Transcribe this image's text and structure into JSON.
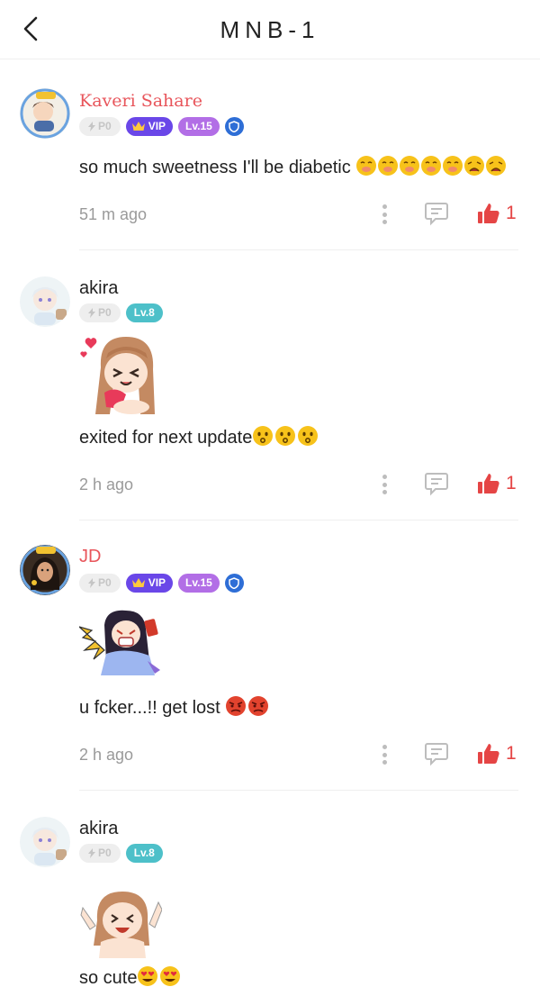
{
  "header": {
    "title": "MNB-1"
  },
  "comments": [
    {
      "username": "Kaveri Sahare",
      "badges": {
        "points": "P0",
        "vip": "VIP",
        "level": "Lv.15"
      },
      "text": "so much sweetness I'll be diabetic",
      "time": "51 m ago",
      "likes": "1"
    },
    {
      "username": "akira",
      "badges": {
        "points": "P0",
        "level": "Lv.8"
      },
      "text": "exited for next update",
      "time": "2 h ago",
      "likes": "1"
    },
    {
      "username": "JD",
      "badges": {
        "points": "P0",
        "vip": "VIP",
        "level": "Lv.15"
      },
      "text": "u fcker...!! get lost",
      "time": "2 h ago",
      "likes": "1"
    },
    {
      "username": "akira",
      "badges": {
        "points": "P0",
        "level": "Lv.8"
      },
      "text": "so cute"
    }
  ],
  "colors": {
    "accent_red": "#e8555b",
    "like_red": "#e54545",
    "vip_purple": "#6a47e8",
    "level_purple": "#b26ee6",
    "level_teal": "#4dc0c9"
  }
}
